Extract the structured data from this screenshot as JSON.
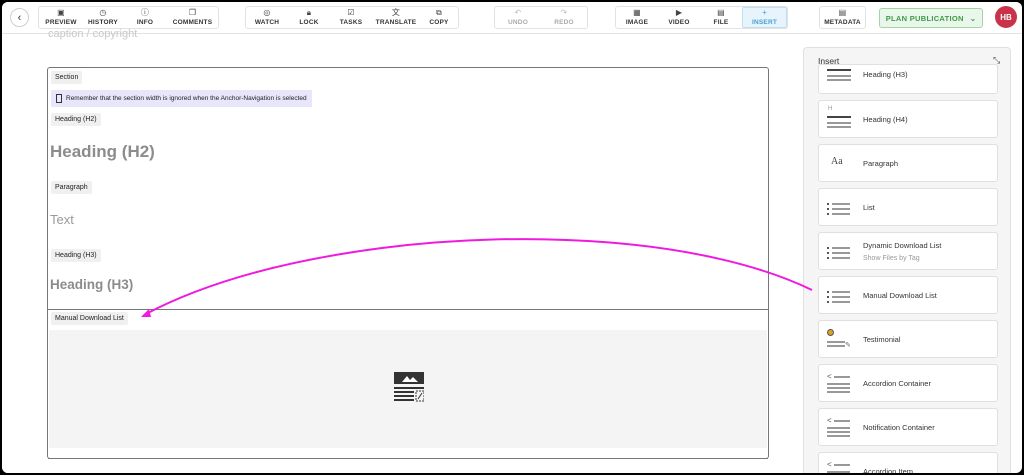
{
  "toolbar": {
    "back_icon": "chevron-left-icon",
    "group1": [
      {
        "label": "PREVIEW",
        "icon": "preview-icon",
        "glyph": "▣"
      },
      {
        "label": "HISTORY",
        "icon": "history-icon",
        "glyph": "◷"
      },
      {
        "label": "INFO",
        "icon": "info-icon",
        "glyph": "ⓘ"
      },
      {
        "label": "COMMENTS",
        "icon": "comments-icon",
        "glyph": "❐"
      }
    ],
    "group2": [
      {
        "label": "WATCH",
        "icon": "eye-slash-icon",
        "glyph": "◎"
      },
      {
        "label": "LOCK",
        "icon": "lock-icon",
        "glyph": "🔒︎"
      },
      {
        "label": "TASKS",
        "icon": "tasks-icon",
        "glyph": "☑"
      },
      {
        "label": "TRANSLATE",
        "icon": "translate-icon",
        "glyph": "文"
      },
      {
        "label": "COPY",
        "icon": "copy-icon",
        "glyph": "⧉"
      }
    ],
    "group3": [
      {
        "label": "UNDO",
        "icon": "undo-icon",
        "glyph": "↶"
      },
      {
        "label": "REDO",
        "icon": "redo-icon",
        "glyph": "↷"
      }
    ],
    "group4": [
      {
        "label": "IMAGE",
        "icon": "image-icon",
        "glyph": "▦"
      },
      {
        "label": "VIDEO",
        "icon": "video-icon",
        "glyph": "▶"
      },
      {
        "label": "FILE",
        "icon": "file-icon",
        "glyph": "▤"
      },
      {
        "label": "INSERT",
        "icon": "plus-icon",
        "glyph": "+"
      }
    ],
    "metadata": {
      "label": "METADATA",
      "icon": "metadata-icon",
      "glyph": "▤"
    },
    "plan_publication": "PLAN PUBLICATION",
    "avatar_initials": "HB",
    "accent_color": "#4a9cd6",
    "plan_color": "#3f9a47",
    "avatar_color": "#c8334a"
  },
  "canvas": {
    "caption": "caption / copyright",
    "section_label": "Section",
    "note": "Remember that the section width is ignored when the Anchor-Navigation is selected",
    "h2_label": "Heading (H2)",
    "h2_text": "Heading (H2)",
    "paragraph_label": "Paragraph",
    "paragraph_text": "Text",
    "h3_label": "Heading (H3)",
    "h3_text": "Heading (H3)",
    "mdl_label": "Manual Download List",
    "arrow_color": "#f01adf"
  },
  "insert_panel": {
    "title": "Insert",
    "items": [
      {
        "name": "Heading (H3)",
        "sub": "",
        "icon": "heading-icon"
      },
      {
        "name": "Heading (H4)",
        "sub": "",
        "icon": "heading-icon"
      },
      {
        "name": "Paragraph",
        "sub": "",
        "icon": "paragraph-icon"
      },
      {
        "name": "List",
        "sub": "",
        "icon": "list-icon"
      },
      {
        "name": "Dynamic Download List",
        "sub": "Show Files by Tag",
        "icon": "list-icon"
      },
      {
        "name": "Manual Download List",
        "sub": "",
        "icon": "list-icon"
      },
      {
        "name": "Testimonial",
        "sub": "",
        "icon": "testimonial-icon"
      },
      {
        "name": "Accordion Container",
        "sub": "",
        "icon": "accordion-icon"
      },
      {
        "name": "Notification Container",
        "sub": "",
        "icon": "accordion-icon"
      },
      {
        "name": "Accordion Item",
        "sub": "",
        "icon": "accordion-icon"
      }
    ]
  }
}
